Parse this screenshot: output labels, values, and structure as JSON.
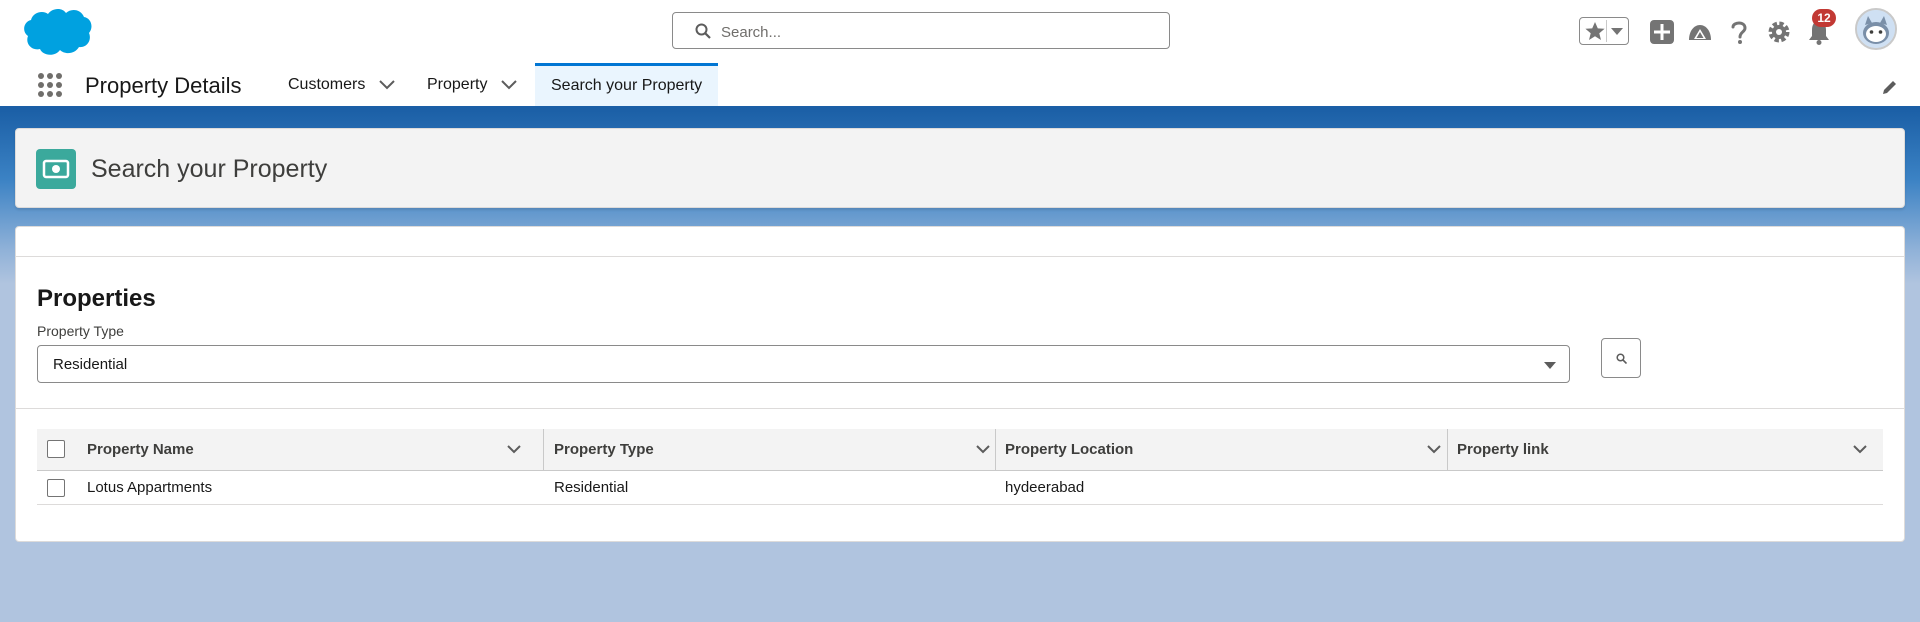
{
  "header": {
    "search_placeholder": "Search...",
    "notification_count": "12"
  },
  "nav": {
    "app_name": "Property Details",
    "items": [
      {
        "label": "Customers"
      },
      {
        "label": "Property"
      },
      {
        "label": "Search your Property"
      }
    ]
  },
  "page": {
    "title": "Search your Property"
  },
  "filter": {
    "section_title": "Properties",
    "field_label": "Property Type",
    "selected_value": "Residential"
  },
  "table": {
    "columns": [
      "Property Name",
      "Property Type",
      "Property Location",
      "Property link"
    ],
    "rows": [
      {
        "name": "Lotus Appartments",
        "type": "Residential",
        "location": "hydeerabad",
        "link": ""
      }
    ]
  },
  "colors": {
    "brand_blue": "#00a1e0",
    "nav_accent": "#0176d3",
    "page_icon": "#3ba99c",
    "badge": "#c23934"
  }
}
